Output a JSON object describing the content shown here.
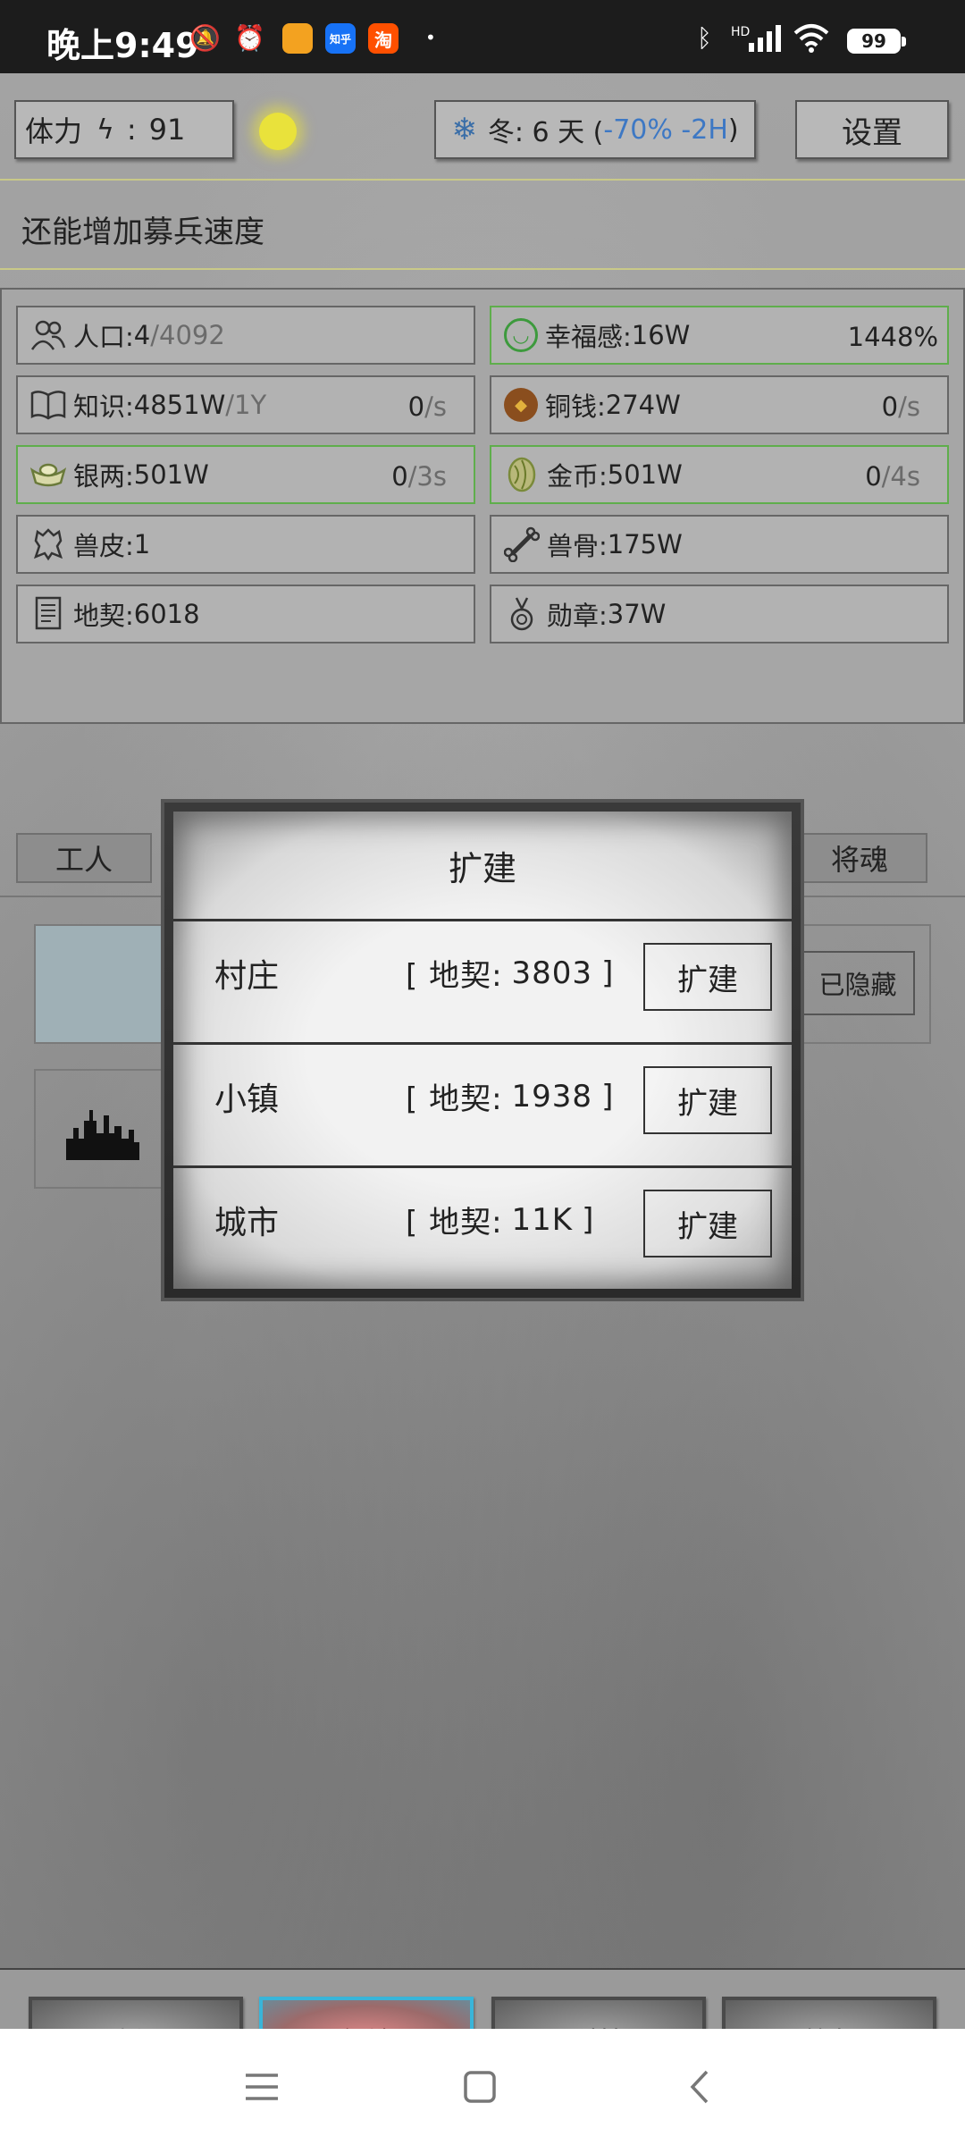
{
  "status_bar": {
    "time": "晚上9:49",
    "apps": [
      "知乎",
      "淘"
    ],
    "battery": "99",
    "network": "HD"
  },
  "top_bar": {
    "stamina_label": "体力",
    "stamina_sep": ":",
    "stamina_value": "91",
    "season_text": "冬: 6 天 (",
    "season_mod": "-70% -2H",
    "season_close": ")",
    "settings_label": "设置"
  },
  "hint": "还能增加募兵速度",
  "resources": [
    {
      "label": "人口:",
      "value": "4",
      "suffix": "/4092",
      "rate": "",
      "rate_unit": "",
      "icon": "people-icon"
    },
    {
      "label": "幸福感:",
      "value": "16W",
      "suffix": "",
      "rate": "1448%",
      "rate_unit": "",
      "icon": "smiley-icon"
    },
    {
      "label": "知识:",
      "value": "4851W",
      "suffix": "/1Y",
      "rate": "0",
      "rate_unit": "/s",
      "icon": "book-icon"
    },
    {
      "label": "铜钱:",
      "value": "274W",
      "suffix": "",
      "rate": "0",
      "rate_unit": "/s",
      "icon": "copper-coin-icon"
    },
    {
      "label": "银两:",
      "value": "501W",
      "suffix": "",
      "rate": "0",
      "rate_unit": "/3s",
      "icon": "silver-ingot-icon"
    },
    {
      "label": "金币:",
      "value": "501W",
      "suffix": "",
      "rate": "0",
      "rate_unit": "/4s",
      "icon": "gold-coin-icon"
    },
    {
      "label": "兽皮:",
      "value": "1",
      "suffix": "",
      "rate": "",
      "rate_unit": "",
      "icon": "hide-icon"
    },
    {
      "label": "兽骨:",
      "value": "175W",
      "suffix": "",
      "rate": "",
      "rate_unit": "",
      "icon": "bone-icon"
    },
    {
      "label": "地契:",
      "value": "6018",
      "suffix": "",
      "rate": "",
      "rate_unit": "",
      "icon": "deed-icon"
    },
    {
      "label": "勋章:",
      "value": "37W",
      "suffix": "",
      "rate": "",
      "rate_unit": "",
      "icon": "medal-icon"
    }
  ],
  "tabs": {
    "left": "工人",
    "right": "将魂"
  },
  "hidden_button": "已隐藏",
  "modal": {
    "title": "扩建",
    "rows": [
      {
        "name": "村庄",
        "cost_prefix": "[ 地契:",
        "cost": "3803",
        "cost_suffix": "]",
        "button": "扩建"
      },
      {
        "name": "小镇",
        "cost_prefix": "[ 地契:",
        "cost": "1938",
        "cost_suffix": "]",
        "button": "扩建"
      },
      {
        "name": "城市",
        "cost_prefix": "[ 地契:",
        "cost": "11K",
        "cost_suffix": "]",
        "button": "扩建"
      }
    ]
  },
  "bottom_tabs": [
    {
      "label": "资源",
      "active": false
    },
    {
      "label": "领地",
      "active": true
    },
    {
      "label": "科技",
      "active": false
    },
    {
      "label": "战争",
      "active": false
    }
  ],
  "colors": {
    "accent_blue": "#3d78c4",
    "green_border": "#5fae4c",
    "active_tab_border": "#39b5d9"
  }
}
